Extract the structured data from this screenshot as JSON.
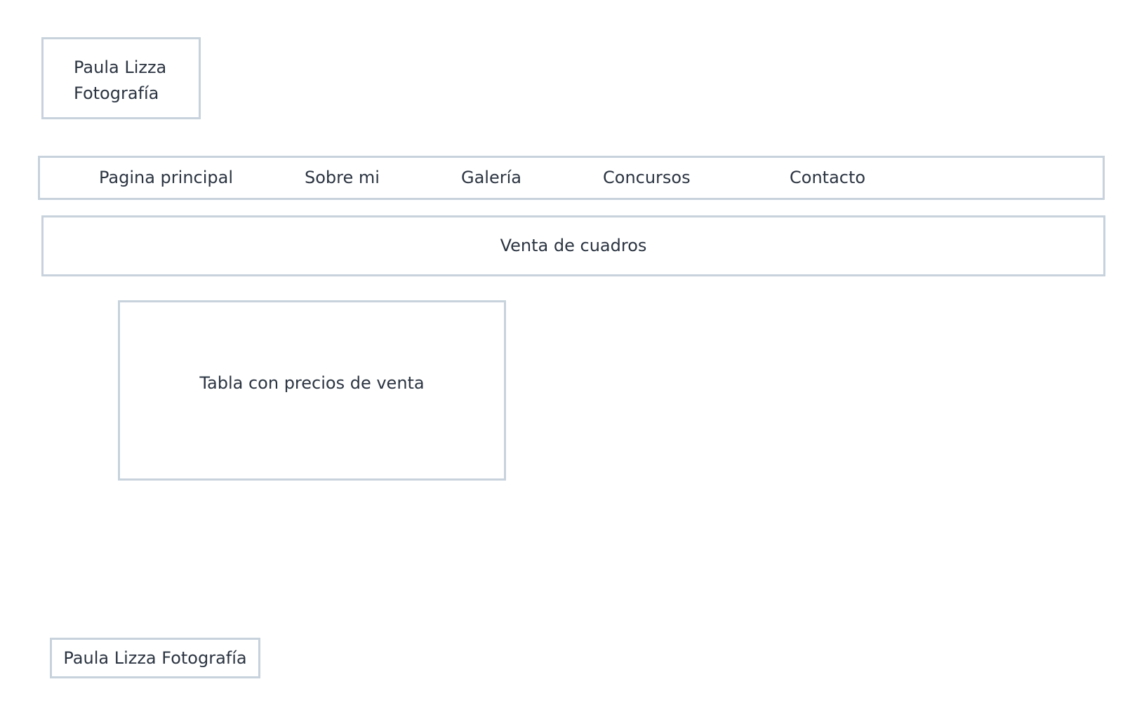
{
  "header": {
    "logo_line1": "Paula Lizza",
    "logo_line2": "Fotografía"
  },
  "nav": {
    "items": [
      {
        "label": "Pagina principal"
      },
      {
        "label": "Sobre mi"
      },
      {
        "label": "Galería"
      },
      {
        "label": "Concursos"
      },
      {
        "label": "Contacto"
      }
    ]
  },
  "main": {
    "section_title": "Venta de cuadros",
    "table_placeholder": "Tabla con precios de venta"
  },
  "footer": {
    "text": "Paula Lizza Fotografía"
  },
  "colors": {
    "border": "#c7d2dc",
    "text": "#2b3441",
    "background": "#ffffff"
  }
}
